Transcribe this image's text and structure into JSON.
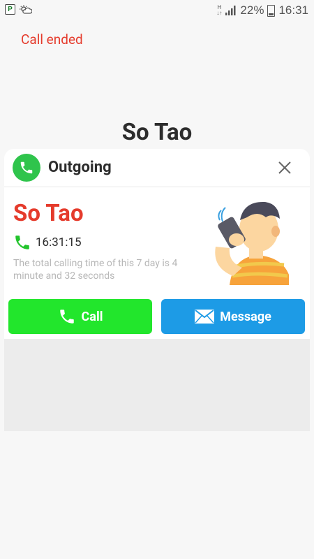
{
  "status_bar": {
    "left_icons": [
      "parking-icon",
      "weather-icon"
    ],
    "network": "H",
    "battery": "22%",
    "time": "16:31"
  },
  "call_status": "Call ended",
  "caller_name": "So Tao",
  "card": {
    "title": "Outgoing",
    "contact_name": "So Tao",
    "call_time": "16:31:15",
    "summary": "The total calling time of this 7 day is 4 minute and 32 seconds",
    "buttons": {
      "call_label": "Call",
      "message_label": "Message"
    }
  },
  "colors": {
    "accent_red": "#e53b2c",
    "call_green": "#22e62c",
    "message_blue": "#1d9be6",
    "header_icon_green": "#2fc44c"
  }
}
